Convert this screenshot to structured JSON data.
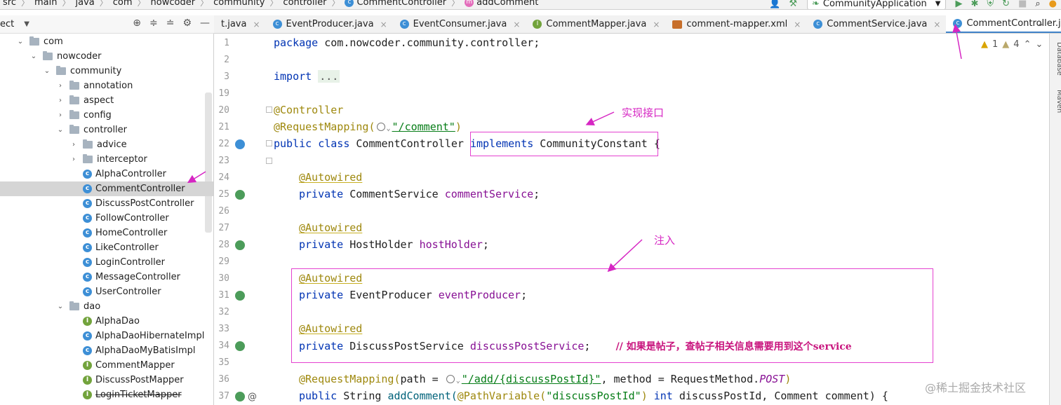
{
  "breadcrumb": [
    "src",
    "main",
    "java",
    "com",
    "nowcoder",
    "community",
    "controller",
    "CommentController",
    "addComment"
  ],
  "run_config": "CommunityApplication",
  "project_panel": {
    "title": "ect"
  },
  "tabs": [
    {
      "label": "t.java",
      "icon": "none"
    },
    {
      "label": "EventProducer.java",
      "icon": "class"
    },
    {
      "label": "EventConsumer.java",
      "icon": "class"
    },
    {
      "label": "CommentMapper.java",
      "icon": "interface"
    },
    {
      "label": "comment-mapper.xml",
      "icon": "xml"
    },
    {
      "label": "CommentService.java",
      "icon": "class"
    },
    {
      "label": "CommentController.java",
      "icon": "class",
      "active": true
    }
  ],
  "tree": [
    {
      "label": "com",
      "type": "folder",
      "open": true,
      "depth": 0
    },
    {
      "label": "nowcoder",
      "type": "folder",
      "open": true,
      "depth": 1
    },
    {
      "label": "community",
      "type": "folder",
      "open": true,
      "depth": 2
    },
    {
      "label": "annotation",
      "type": "folder",
      "open": false,
      "depth": 3
    },
    {
      "label": "aspect",
      "type": "folder",
      "open": false,
      "depth": 3
    },
    {
      "label": "config",
      "type": "folder",
      "open": false,
      "depth": 3
    },
    {
      "label": "controller",
      "type": "folder",
      "open": true,
      "depth": 3
    },
    {
      "label": "advice",
      "type": "folder",
      "open": false,
      "depth": 4
    },
    {
      "label": "interceptor",
      "type": "folder",
      "open": false,
      "depth": 4
    },
    {
      "label": "AlphaController",
      "type": "class",
      "depth": 4
    },
    {
      "label": "CommentController",
      "type": "class",
      "depth": 4,
      "selected": true
    },
    {
      "label": "DiscussPostController",
      "type": "class",
      "depth": 4
    },
    {
      "label": "FollowController",
      "type": "class",
      "depth": 4
    },
    {
      "label": "HomeController",
      "type": "class",
      "depth": 4
    },
    {
      "label": "LikeController",
      "type": "class",
      "depth": 4
    },
    {
      "label": "LoginController",
      "type": "class",
      "depth": 4
    },
    {
      "label": "MessageController",
      "type": "class",
      "depth": 4
    },
    {
      "label": "UserController",
      "type": "class",
      "depth": 4
    },
    {
      "label": "dao",
      "type": "folder",
      "open": true,
      "depth": 3
    },
    {
      "label": "AlphaDao",
      "type": "interface",
      "depth": 4
    },
    {
      "label": "AlphaDaoHibernateImpl",
      "type": "class",
      "depth": 4
    },
    {
      "label": "AlphaDaoMyBatisImpl",
      "type": "class",
      "depth": 4
    },
    {
      "label": "CommentMapper",
      "type": "interface",
      "depth": 4
    },
    {
      "label": "DiscussPostMapper",
      "type": "interface",
      "depth": 4
    },
    {
      "label": "LoginTicketMapper",
      "type": "interface",
      "depth": 4,
      "strike": true
    }
  ],
  "line_numbers": [
    "1",
    "2",
    "3",
    "19",
    "20",
    "21",
    "22",
    "23",
    "24",
    "25",
    "26",
    "27",
    "28",
    "29",
    "30",
    "31",
    "32",
    "33",
    "34",
    "35",
    "36",
    "37"
  ],
  "code": {
    "l1_kw": "package",
    "l1_rest": " com.nowcoder.community.controller;",
    "l3_kw": "import",
    "l3_fold": "...",
    "l20_ann": "@Controller",
    "l21_ann": "@RequestMapping(",
    "l21_str": "\"/comment\"",
    "l21_end": ")",
    "l22_kw1": "public",
    "l22_kw2": "class",
    "l22_name": " CommentController ",
    "l22_kw3": "implements",
    "l22_iface": " CommunityConstant ",
    "l22_brace": "{",
    "autowired": "@Autowired",
    "private": "private",
    "l25_type": " CommentService ",
    "l25_field": "commentService",
    "semi": ";",
    "l28_type": " HostHolder ",
    "l28_field": "hostHolder",
    "l31_type": " EventProducer ",
    "l31_field": "eventProducer",
    "l34_type": " DiscussPostService ",
    "l34_field": "discussPostService",
    "l34_comment": "// 如果是帖子，查帖子相关信息需要用到这个service",
    "l36_ann": "@RequestMapping(",
    "l36_mid": "path = ",
    "l36_str": "\"/add/{discussPostId}\"",
    "l36_mid2": ", method = RequestMethod.",
    "l36_post": "POST",
    "l36_end": ")",
    "l37_kw1": "public",
    "l37_type": " String ",
    "l37_name": "addComment(",
    "l37_ann": "@PathVariable(",
    "l37_str": "\"discussPostId\"",
    "l37_ann_end": ")",
    "l37_kw2": " int",
    "l37_rest": " discussPostId, Comment comment) {"
  },
  "annotations": {
    "implement_note": "实现接口",
    "inject_note": "注入"
  },
  "warnings": {
    "warn_count": "1",
    "weak_count": "4"
  },
  "right_labels": [
    "Database",
    "Maven"
  ],
  "watermark": "@稀土掘金技术社区"
}
